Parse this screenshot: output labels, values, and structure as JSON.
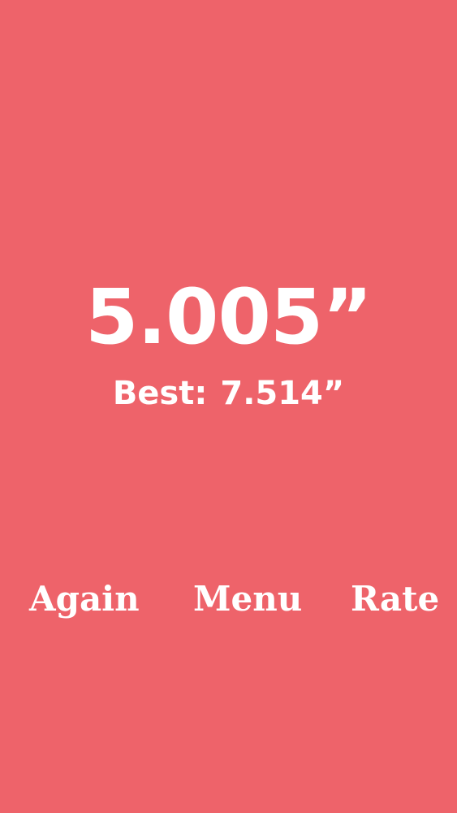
{
  "game": {
    "score": "5.005”",
    "best_label": "Best:",
    "best_value": "7.514”"
  },
  "actions": {
    "again": "Again",
    "menu": "Menu",
    "rate": "Rate"
  },
  "colors": {
    "background": "#ee636a",
    "text": "#ffffff"
  }
}
